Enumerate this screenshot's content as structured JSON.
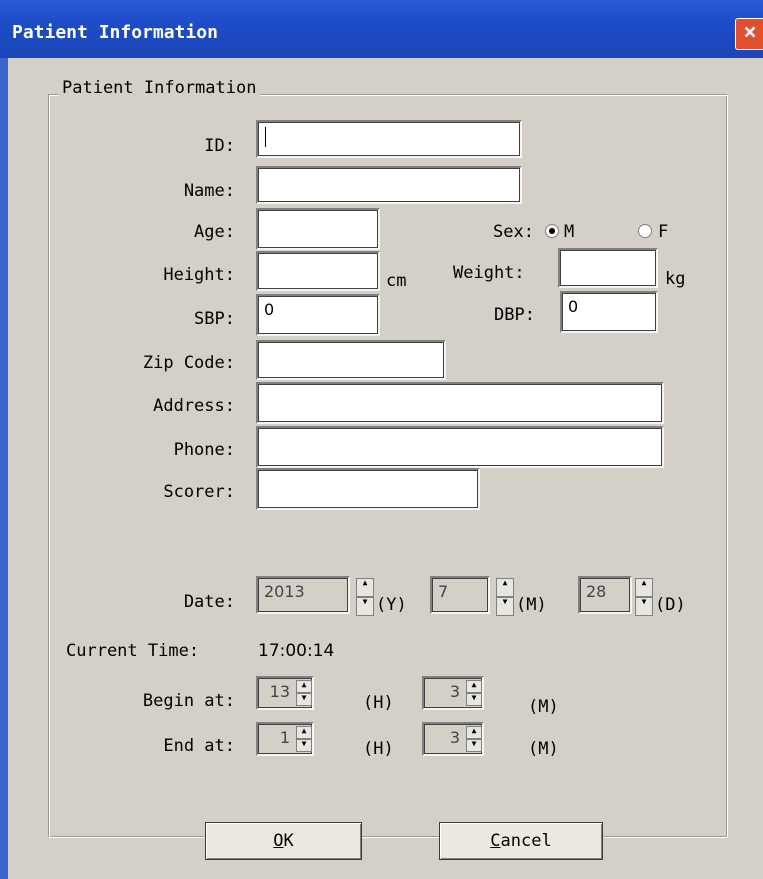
{
  "window": {
    "title": "Patient Information",
    "close_glyph": "×"
  },
  "group": {
    "legend": "Patient Information"
  },
  "labels": {
    "id": "ID:",
    "name": "Name:",
    "age": "Age:",
    "sex": "Sex:",
    "height": "Height:",
    "height_unit": "cm",
    "weight": "Weight:",
    "weight_unit": "kg",
    "sbp": "SBP:",
    "dbp": "DBP:",
    "zip": "Zip Code:",
    "address": "Address:",
    "phone": "Phone:",
    "scorer": "Scorer:",
    "date": "Date:",
    "year_unit": "(Y)",
    "month_unit": "(M)",
    "day_unit": "(D)",
    "current_time": "Current Time:",
    "begin_at": "Begin at:",
    "end_at": "End at:",
    "hour_unit": "(H)",
    "minute_unit": "(M)"
  },
  "fields": {
    "id": "",
    "name": "",
    "age": "",
    "height": "",
    "weight": "",
    "sbp": "0",
    "dbp": "0",
    "zip": "",
    "address": "",
    "phone": "",
    "scorer": ""
  },
  "sex": {
    "options": [
      "M",
      "F"
    ],
    "selected": "M"
  },
  "date": {
    "year": "2013",
    "month": "7",
    "day": "28"
  },
  "current_time": "17:00:14",
  "begin": {
    "hour": "13",
    "minute": "3"
  },
  "end": {
    "hour": "1",
    "minute": "3"
  },
  "buttons": {
    "ok": "OK",
    "ok_mnemonic": "O",
    "ok_rest": "K",
    "cancel_mnemonic": "C",
    "cancel_rest": "ancel"
  }
}
